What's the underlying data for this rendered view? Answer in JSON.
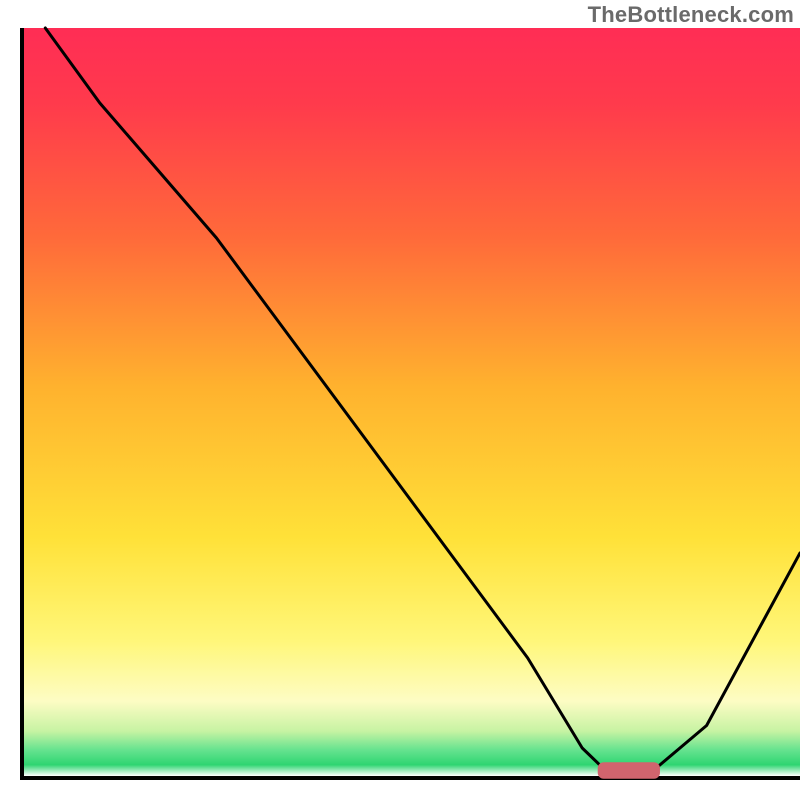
{
  "watermark": "TheBottleneck.com",
  "chart_data": {
    "type": "line",
    "title": "",
    "xlabel": "",
    "ylabel": "",
    "xlim": [
      0,
      100
    ],
    "ylim": [
      0,
      100
    ],
    "grid": false,
    "legend": false,
    "series": [
      {
        "name": "bottleneck-curve",
        "color": "#000000",
        "x": [
          3,
          10,
          20,
          25,
          35,
          45,
          55,
          65,
          72,
          76,
          80,
          88,
          100
        ],
        "y": [
          100,
          90,
          78,
          72,
          58,
          44,
          30,
          16,
          4,
          0,
          0,
          7,
          30
        ]
      }
    ],
    "marker": {
      "name": "optimal-range",
      "color": "#d1646e",
      "x_start": 74,
      "x_end": 82,
      "y": 1,
      "thickness": 2.2
    },
    "background": {
      "type": "vertical-gradient",
      "stops": [
        {
          "pos": 0,
          "color": "#ff2d55"
        },
        {
          "pos": 0.1,
          "color": "#ff3a4c"
        },
        {
          "pos": 0.28,
          "color": "#ff6a3a"
        },
        {
          "pos": 0.48,
          "color": "#ffb22e"
        },
        {
          "pos": 0.68,
          "color": "#ffe138"
        },
        {
          "pos": 0.82,
          "color": "#fff77a"
        },
        {
          "pos": 0.9,
          "color": "#fdfcc4"
        },
        {
          "pos": 0.94,
          "color": "#c7f3a3"
        },
        {
          "pos": 0.965,
          "color": "#66e38f"
        },
        {
          "pos": 0.985,
          "color": "#2fd571"
        },
        {
          "pos": 1.0,
          "color": "#ffffff"
        }
      ]
    },
    "axes_color": "#000000",
    "axes_width": 4
  }
}
